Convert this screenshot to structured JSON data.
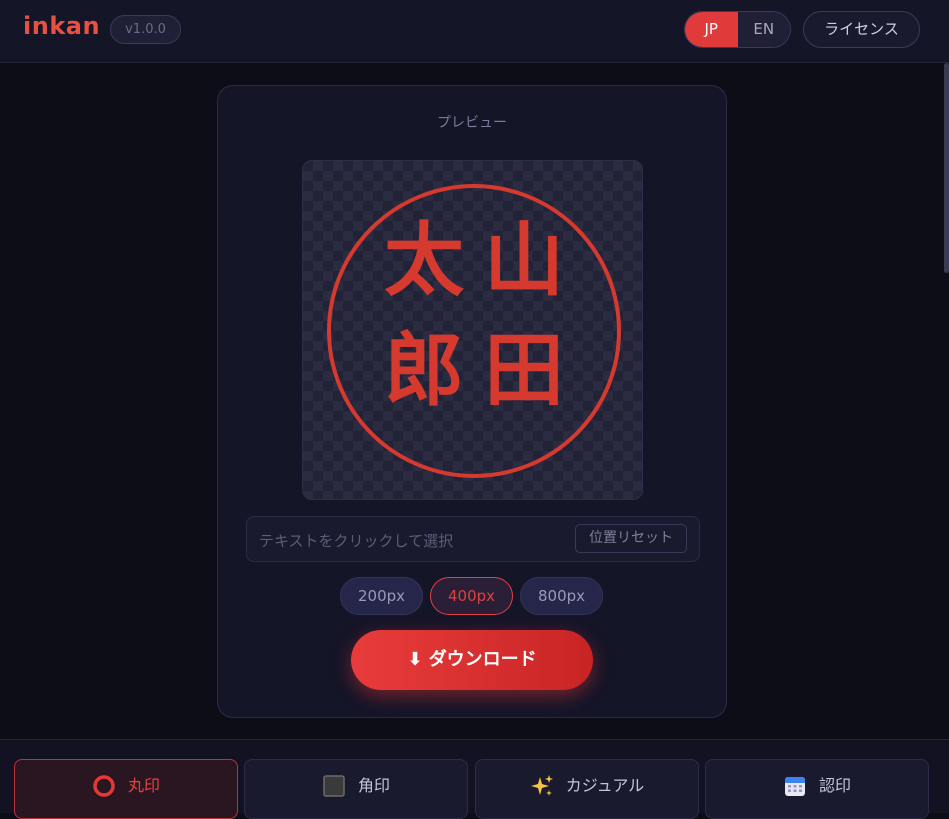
{
  "header": {
    "logo": "inkan",
    "version": "v1.0.0",
    "lang_jp": "JP",
    "lang_en": "EN",
    "license": "ライセンス"
  },
  "preview": {
    "title": "プレビュー",
    "stamp_chars": [
      "山",
      "田",
      "太",
      "郎"
    ],
    "stamp_color": "#d63a2e",
    "hint": "テキストをクリックして選択",
    "reset": "位置リセット"
  },
  "sizes": [
    "200px",
    "400px",
    "800px"
  ],
  "selected_size": "400px",
  "download": {
    "icon": "⬇",
    "label": "ダウンロード"
  },
  "tabs": [
    {
      "icon": "circle-stamp-icon",
      "label": "丸印"
    },
    {
      "icon": "square-stamp-icon",
      "label": "角印"
    },
    {
      "icon": "sparkles-icon",
      "label": "カジュアル"
    },
    {
      "icon": "calendar-icon",
      "label": "認印"
    }
  ],
  "accent_color": "#e03a3a"
}
